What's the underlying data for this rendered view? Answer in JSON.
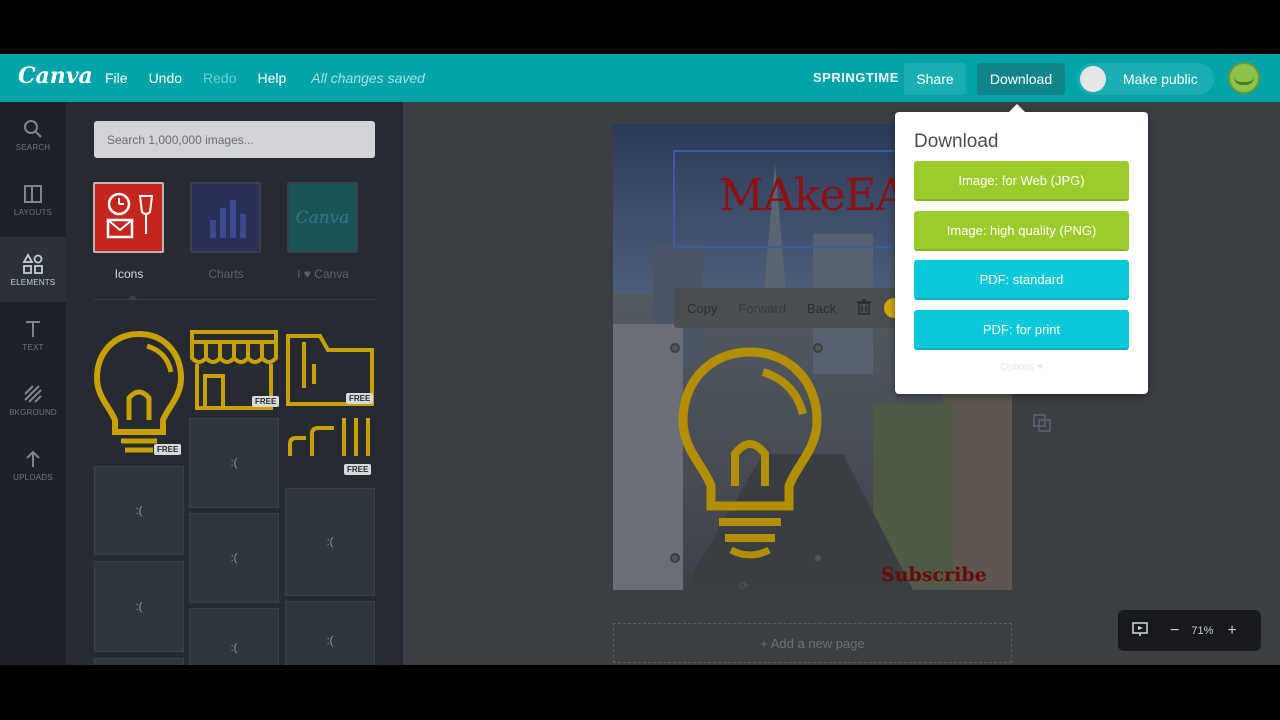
{
  "app": {
    "logo": "Canva",
    "menu": {
      "file": "File",
      "undo": "Undo",
      "redo": "Redo",
      "help": "Help",
      "status": "All changes saved"
    },
    "doc_title": "SPRINGTIME",
    "share_label": "Share",
    "download_label": "Download",
    "make_public_label": "Make public"
  },
  "rail": {
    "search": "SEARCH",
    "layouts": "LAYOUTS",
    "elements": "ELEMENTS",
    "text": "TEXT",
    "background": "BKGROUND",
    "uploads": "UPLOADS"
  },
  "panel": {
    "search_placeholder": "Search 1,000,000 images...",
    "categories": [
      {
        "label": "Icons"
      },
      {
        "label": "Charts"
      },
      {
        "label": "I ♥ Canva"
      }
    ],
    "canva_thumb_text": "Canva",
    "free_badge": "FREE",
    "loading_glyph": ":("
  },
  "design": {
    "title_text": "MAkeEAsy",
    "subscribe_text": "Subscribe",
    "add_page_label": "+ Add a new page"
  },
  "element_toolbar": {
    "copy": "Copy",
    "forward": "Forward",
    "back": "Back"
  },
  "download_menu": {
    "title": "Download",
    "options": [
      {
        "label": "Image: for Web (JPG)",
        "color": "#9ccb2c"
      },
      {
        "label": "Image: high quality (PNG)",
        "color": "#9ccb2c"
      },
      {
        "label": "PDF: standard",
        "color": "#0bc7da"
      },
      {
        "label": "PDF: for print",
        "color": "#0bc7da"
      }
    ],
    "more_options": "Options ▾"
  },
  "zoom": {
    "minus": "−",
    "value": "71%",
    "plus": "+"
  },
  "colors": {
    "brand_teal": "#00a3a8",
    "icon_gold": "#d0a800",
    "rail_bg": "#1d2127"
  }
}
